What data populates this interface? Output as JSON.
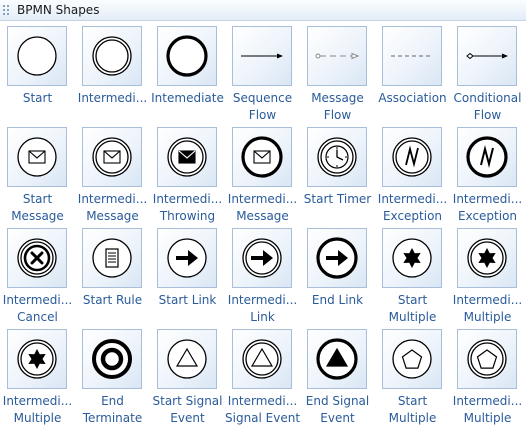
{
  "panel": {
    "title": "BPMN Shapes"
  },
  "shapes": [
    {
      "icon": "start-event-icon",
      "line1": "Start",
      "line2": ""
    },
    {
      "icon": "intermediate-event-icon",
      "line1": "Intermedi...",
      "line2": ""
    },
    {
      "icon": "end-event-icon",
      "line1": "Intemediate",
      "line2": ""
    },
    {
      "icon": "sequence-flow-icon",
      "line1": "Sequence",
      "line2": "Flow"
    },
    {
      "icon": "message-flow-icon",
      "line1": "Message",
      "line2": "Flow"
    },
    {
      "icon": "association-icon",
      "line1": "Association",
      "line2": ""
    },
    {
      "icon": "conditional-flow-icon",
      "line1": "Conditional",
      "line2": "Flow"
    },
    {
      "icon": "start-message-icon",
      "line1": "Start",
      "line2": "Message"
    },
    {
      "icon": "intermediate-message-icon",
      "line1": "Intermedi...",
      "line2": "Message"
    },
    {
      "icon": "intermediate-throwing-icon",
      "line1": "Intermedi...",
      "line2": "Throwing"
    },
    {
      "icon": "end-message-icon",
      "line1": "Intermedi...",
      "line2": "Message"
    },
    {
      "icon": "start-timer-icon",
      "line1": "Start Timer",
      "line2": ""
    },
    {
      "icon": "intermediate-exception-icon",
      "line1": "Intermedi...",
      "line2": "Exception"
    },
    {
      "icon": "end-exception-icon",
      "line1": "Intermedi...",
      "line2": "Exception"
    },
    {
      "icon": "intermediate-cancel-icon",
      "line1": "Intermedi...",
      "line2": "Cancel"
    },
    {
      "icon": "start-rule-icon",
      "line1": "Start Rule",
      "line2": ""
    },
    {
      "icon": "start-link-icon",
      "line1": "Start Link",
      "line2": ""
    },
    {
      "icon": "intermediate-link-icon",
      "line1": "Intermedi...",
      "line2": "Link"
    },
    {
      "icon": "end-link-icon",
      "line1": "End Link",
      "line2": ""
    },
    {
      "icon": "start-multiple-icon",
      "line1": "Start",
      "line2": "Multiple"
    },
    {
      "icon": "intermediate-multiple-icon",
      "line1": "Intermedi...",
      "line2": "Multiple"
    },
    {
      "icon": "intermediate-multiple-filled-icon",
      "line1": "Intermedi...",
      "line2": "Multiple"
    },
    {
      "icon": "end-terminate-icon",
      "line1": "End",
      "line2": "Terminate"
    },
    {
      "icon": "start-signal-icon",
      "line1": "Start Signal",
      "line2": "Event"
    },
    {
      "icon": "intermediate-signal-icon",
      "line1": "Intermedi...",
      "line2": "Signal Event"
    },
    {
      "icon": "end-signal-icon",
      "line1": "End Signal",
      "line2": "Event"
    },
    {
      "icon": "start-multiple-pentagon-icon",
      "line1": "Start",
      "line2": "Multiple"
    },
    {
      "icon": "intermediate-multiple-pentagon-icon",
      "line1": "Intermedi...",
      "line2": "Multiple"
    }
  ]
}
